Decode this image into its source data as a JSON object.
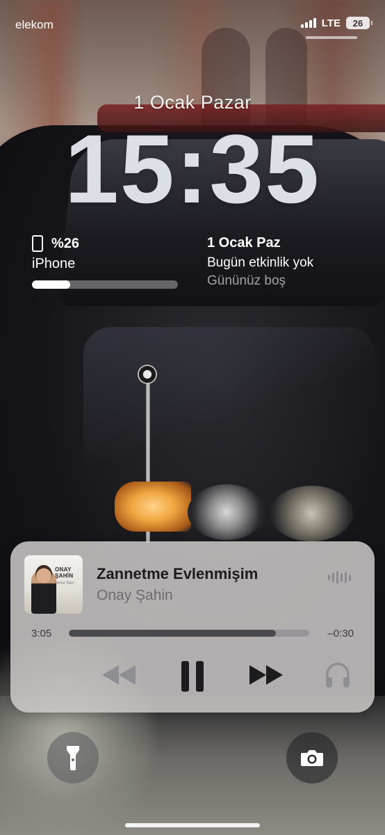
{
  "status_bar": {
    "carrier": "elekom",
    "network": "LTE",
    "battery_level": "26"
  },
  "lock_screen": {
    "date": "1 Ocak Pazar",
    "time": "15:35"
  },
  "widgets": {
    "battery": {
      "percent_label": "%26",
      "device": "iPhone",
      "level_fraction": 0.26
    },
    "calendar": {
      "title": "1 Ocak Paz",
      "line1": "Bugün etkinlik yok",
      "line2": "Gününüz boş"
    }
  },
  "now_playing": {
    "album_art_text": "ONAY ŞAHİN",
    "album_art_subtext": "Horoz Dayı",
    "title": "Zannetme Evlenmişim",
    "artist": "Onay Şahin",
    "elapsed": "3:05",
    "remaining": "–0:30",
    "progress_fraction": 0.86,
    "icons": {
      "rewind": "backward-icon",
      "pause": "pause-icon",
      "forward": "forward-icon",
      "output": "headphones-icon",
      "waveform": "waveform-icon"
    }
  },
  "bottom_buttons": {
    "left_icon": "flashlight-icon",
    "right_icon": "camera-icon"
  },
  "colors": {
    "clock_text": "#ECF0F6",
    "player_bg": "#CDC8C8",
    "title_text": "#1C1C1E",
    "artist_text": "#6C6C70"
  }
}
